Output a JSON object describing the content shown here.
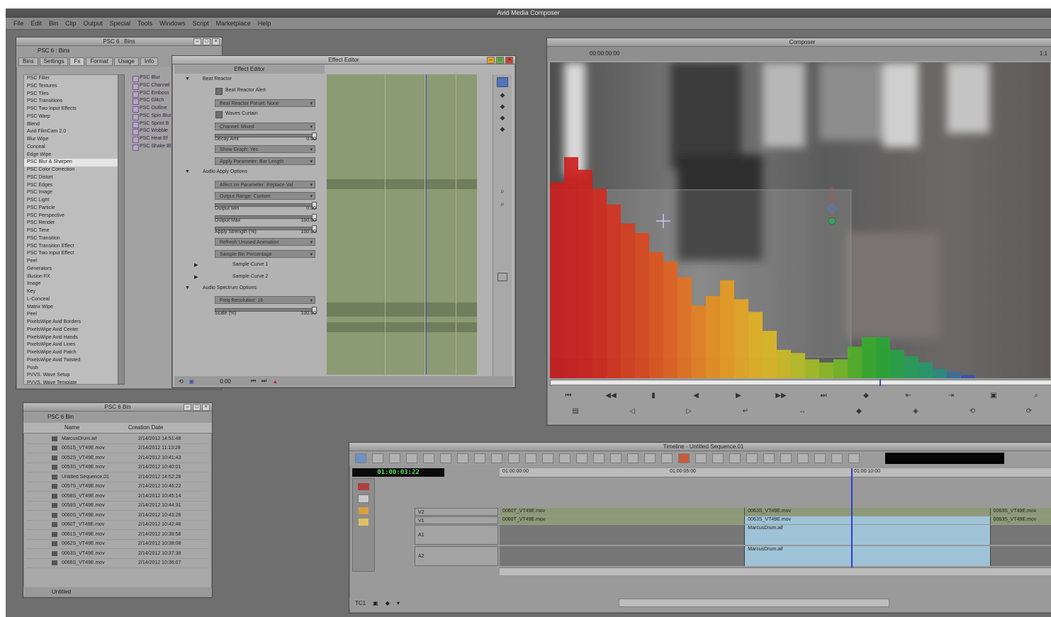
{
  "app": {
    "title": "Avid Media Composer"
  },
  "menu": [
    "File",
    "Edit",
    "Bin",
    "Clip",
    "Output",
    "Special",
    "Tools",
    "Windows",
    "Script",
    "Marketplace",
    "Help"
  ],
  "bin_panel": {
    "title": "PSC 6 : Bins",
    "header": "PSC 6 : Bins",
    "tabs": [
      "Bins",
      "Settings",
      "Fx",
      "Format",
      "Usage",
      "Info"
    ],
    "effects": [
      "PSC Filter",
      "PSC Textures",
      "PSC Tiles",
      "PSC Transitions",
      "PSC Two Input Effects",
      "PSC Warp",
      "Blend",
      "Avid FilmCam 2.0",
      "Blur Wipe",
      "Conceal",
      "Edge Wipe",
      "PSC Blur & Sharpen",
      "PSC Color Correction",
      "PSC Distort",
      "PSC Edges",
      "PSC Image",
      "PSC Light",
      "PSC Particle",
      "PSC Perspective",
      "PSC Render",
      "PSC Time",
      "PSC Transition",
      "PSC Transition Effect",
      "PSC Two Input Effect",
      "Peel",
      "Generators",
      "Illusion FX",
      "Image",
      "Key",
      "L-Conceal",
      "Matrix Wipe",
      "Peel",
      "PixelsWipe Avid Borders",
      "PixelsWipe Avid Center",
      "PixelsWipe Avid Hands",
      "PixelsWipe Avid Lines",
      "PixelsWipe Avid Patch",
      "PixelsWipe Avid Twisted",
      "Push",
      "PVVS. Wave Setup",
      "PVVS. Wave Template"
    ],
    "selected_index": 11,
    "presets": [
      "PSC Blur",
      "PSC Channel",
      "PSC Emboss",
      "PSC Glitch",
      "PSC Outline",
      "PSC Spin Blur",
      "PSC Sprint B",
      "PSC Wobble",
      "PSC Heat Ef",
      "PSC Shake Bl"
    ]
  },
  "effect_editor": {
    "title": "Effect Editor",
    "header": "Effect Editor",
    "rows": [
      {
        "kind": "section",
        "label": "Beat Reactor"
      },
      {
        "kind": "check",
        "label": "Beat Reactor Alert"
      },
      {
        "kind": "dropdown",
        "label": "Beat Reactor Preset: None"
      },
      {
        "kind": "check",
        "label": "Waves Curtain"
      },
      {
        "kind": "dropdown",
        "label": "Channel: Mixed"
      },
      {
        "kind": "slider",
        "label": "Decay Amt",
        "value": "0.00"
      },
      {
        "kind": "dropdown",
        "label": "Show Graph: Yes"
      },
      {
        "kind": "dropdown",
        "label": "Apply Parameter: Bar Length"
      },
      {
        "kind": "section",
        "label": "Audio Apply Options"
      },
      {
        "kind": "dropdown",
        "label": "Affect on Parameter: Replace Val"
      },
      {
        "kind": "dropdown",
        "label": "Output Range: Custom"
      },
      {
        "kind": "slider",
        "label": "Output Min",
        "value": "0.00"
      },
      {
        "kind": "slider",
        "label": "Output Max",
        "value": "100.00"
      },
      {
        "kind": "slider",
        "label": "Apply Strength (%)",
        "value": "100.00"
      },
      {
        "kind": "dropdown",
        "label": "Refresh Unused Animation"
      },
      {
        "kind": "dropdown",
        "label": "Sample Bin Percentage"
      },
      {
        "kind": "sub",
        "label": "Sample Curve 1"
      },
      {
        "kind": "sub",
        "label": "Sample Curve 2"
      },
      {
        "kind": "section",
        "label": "Audio Spectrum Options"
      },
      {
        "kind": "dropdown",
        "label": "Freq Resolution: 16"
      },
      {
        "kind": "slider",
        "label": "Scale (%)",
        "value": "100.00"
      }
    ],
    "footer": {
      "value": "0.00"
    }
  },
  "composer": {
    "title": "Composer",
    "timecode": "00:00:00:00",
    "zoom": "1:1",
    "histogram": [
      {
        "h": 0.62,
        "color": "#c81e1e"
      },
      {
        "h": 0.7,
        "color": "#cc2020"
      },
      {
        "h": 0.66,
        "color": "#cc2320"
      },
      {
        "h": 0.6,
        "color": "#cf2a1f"
      },
      {
        "h": 0.55,
        "color": "#d3341f"
      },
      {
        "h": 0.49,
        "color": "#d63e1f"
      },
      {
        "h": 0.46,
        "color": "#d9481f"
      },
      {
        "h": 0.4,
        "color": "#dc5620"
      },
      {
        "h": 0.37,
        "color": "#e06320"
      },
      {
        "h": 0.32,
        "color": "#e27221"
      },
      {
        "h": 0.23,
        "color": "#e48121"
      },
      {
        "h": 0.26,
        "color": "#e68f21"
      },
      {
        "h": 0.31,
        "color": "#e69b21"
      },
      {
        "h": 0.25,
        "color": "#e5a623"
      },
      {
        "h": 0.21,
        "color": "#e3b124"
      },
      {
        "h": 0.15,
        "color": "#dcb826"
      },
      {
        "h": 0.09,
        "color": "#cdbb27"
      },
      {
        "h": 0.08,
        "color": "#bcbe28"
      },
      {
        "h": 0.06,
        "color": "#a5bd28"
      },
      {
        "h": 0.05,
        "color": "#8dba28"
      },
      {
        "h": 0.06,
        "color": "#74b629"
      },
      {
        "h": 0.1,
        "color": "#52b02a"
      },
      {
        "h": 0.13,
        "color": "#36ab2c"
      },
      {
        "h": 0.13,
        "color": "#2aa635"
      },
      {
        "h": 0.09,
        "color": "#28a146"
      },
      {
        "h": 0.07,
        "color": "#279c58"
      },
      {
        "h": 0.05,
        "color": "#26976a"
      },
      {
        "h": 0.03,
        "color": "#2a8b82"
      },
      {
        "h": 0.02,
        "color": "#3b6f9b"
      },
      {
        "h": 0.01,
        "color": "#3b4fab"
      }
    ],
    "controls_row1": [
      "⏮",
      "◀◀",
      "▮",
      "◀",
      "▶",
      "▶▶",
      "⏭",
      "◆",
      "⇤",
      "⇥",
      "▣",
      "⌕"
    ],
    "controls_row2": [
      "▤",
      "◁",
      "▷",
      "↵",
      "↔",
      "◆",
      "◈",
      "⟲",
      "⟳"
    ]
  },
  "timeline": {
    "title": "Timeline - Untitled Sequence.01",
    "timecode": "01:00:03:22",
    "ruler_start": "01:00:00:00",
    "ruler_mid": "01:00:05:00",
    "ruler_end": "01:00:10:00",
    "tracks": [
      {
        "name": "V2",
        "clips": [
          {
            "label": "0060T_VT49E.mov",
            "start": 0,
            "end": 0.44,
            "type": "v",
            "sel": false
          },
          {
            "label": "0063S_VT49E.mov",
            "start": 0.44,
            "end": 0.88,
            "type": "v",
            "sel": false
          },
          {
            "label": "0063S_VT49E.mov",
            "start": 0.88,
            "end": 1.0,
            "type": "v",
            "sel": false
          }
        ]
      },
      {
        "name": "V1",
        "clips": [
          {
            "label": "0060T_VT49E.mov",
            "start": 0,
            "end": 0.44,
            "type": "v",
            "sel": false
          },
          {
            "label": "0063S_VT49E.mov",
            "start": 0.44,
            "end": 0.88,
            "type": "v",
            "sel": true
          },
          {
            "label": "0063S_VT49E.mov",
            "start": 0.88,
            "end": 1.0,
            "type": "v",
            "sel": false
          }
        ]
      },
      {
        "name": "A1",
        "clips": [
          {
            "label": "",
            "start": 0,
            "end": 0.44,
            "type": "a",
            "sel": false
          },
          {
            "label": "MarcusDrum.aif",
            "start": 0.44,
            "end": 0.88,
            "type": "a",
            "sel": true
          },
          {
            "label": "",
            "start": 0.88,
            "end": 1.0,
            "type": "a",
            "sel": false
          }
        ]
      },
      {
        "name": "A2",
        "clips": [
          {
            "label": "",
            "start": 0,
            "end": 0.44,
            "type": "a",
            "sel": false
          },
          {
            "label": "MarcusDrum.aif",
            "start": 0.44,
            "end": 0.88,
            "type": "a",
            "sel": true
          },
          {
            "label": "",
            "start": 0.88,
            "end": 1.0,
            "type": "a",
            "sel": false
          }
        ]
      }
    ],
    "playhead": 0.63,
    "footer_label": "TC1"
  },
  "small_bin": {
    "title": "PSC 6 Bin",
    "header": "PSC 6 Bin",
    "columns": [
      "Name",
      "Creation Date"
    ],
    "rows": [
      {
        "name": "MarcusDrum.aif",
        "date": "2/14/2012 14:51:48"
      },
      {
        "name": "0051S_VT49E.mov",
        "date": "2/14/2012 11:13:28"
      },
      {
        "name": "0052S_VT49E.mov",
        "date": "2/14/2012 10:41:43"
      },
      {
        "name": "0053S_VT49E.mov",
        "date": "2/14/2012 10:40:01"
      },
      {
        "name": "Untitled Sequence.01",
        "date": "2/14/2012 14:52:28"
      },
      {
        "name": "0057S_VT49E.mov",
        "date": "2/14/2012 10:46:22"
      },
      {
        "name": "0058S_VT49E.mov",
        "date": "2/14/2012 10:45:14"
      },
      {
        "name": "0059S_VT49E.mov",
        "date": "2/14/2012 10:44:31"
      },
      {
        "name": "0060S_VT49E.mov",
        "date": "2/14/2012 10:43:28"
      },
      {
        "name": "0060T_VT49E.mov",
        "date": "2/14/2012 10:42:48"
      },
      {
        "name": "0061S_VT49E.mov",
        "date": "2/14/2012 10:39:58"
      },
      {
        "name": "0062S_VT49E.mov",
        "date": "2/14/2012 10:38:08"
      },
      {
        "name": "0063S_VT49E.mov",
        "date": "2/14/2012 10:37:38"
      },
      {
        "name": "0066S_VT49E.mov",
        "date": "2/14/2012 10:36:07"
      }
    ],
    "footer_label": "Untitled"
  }
}
